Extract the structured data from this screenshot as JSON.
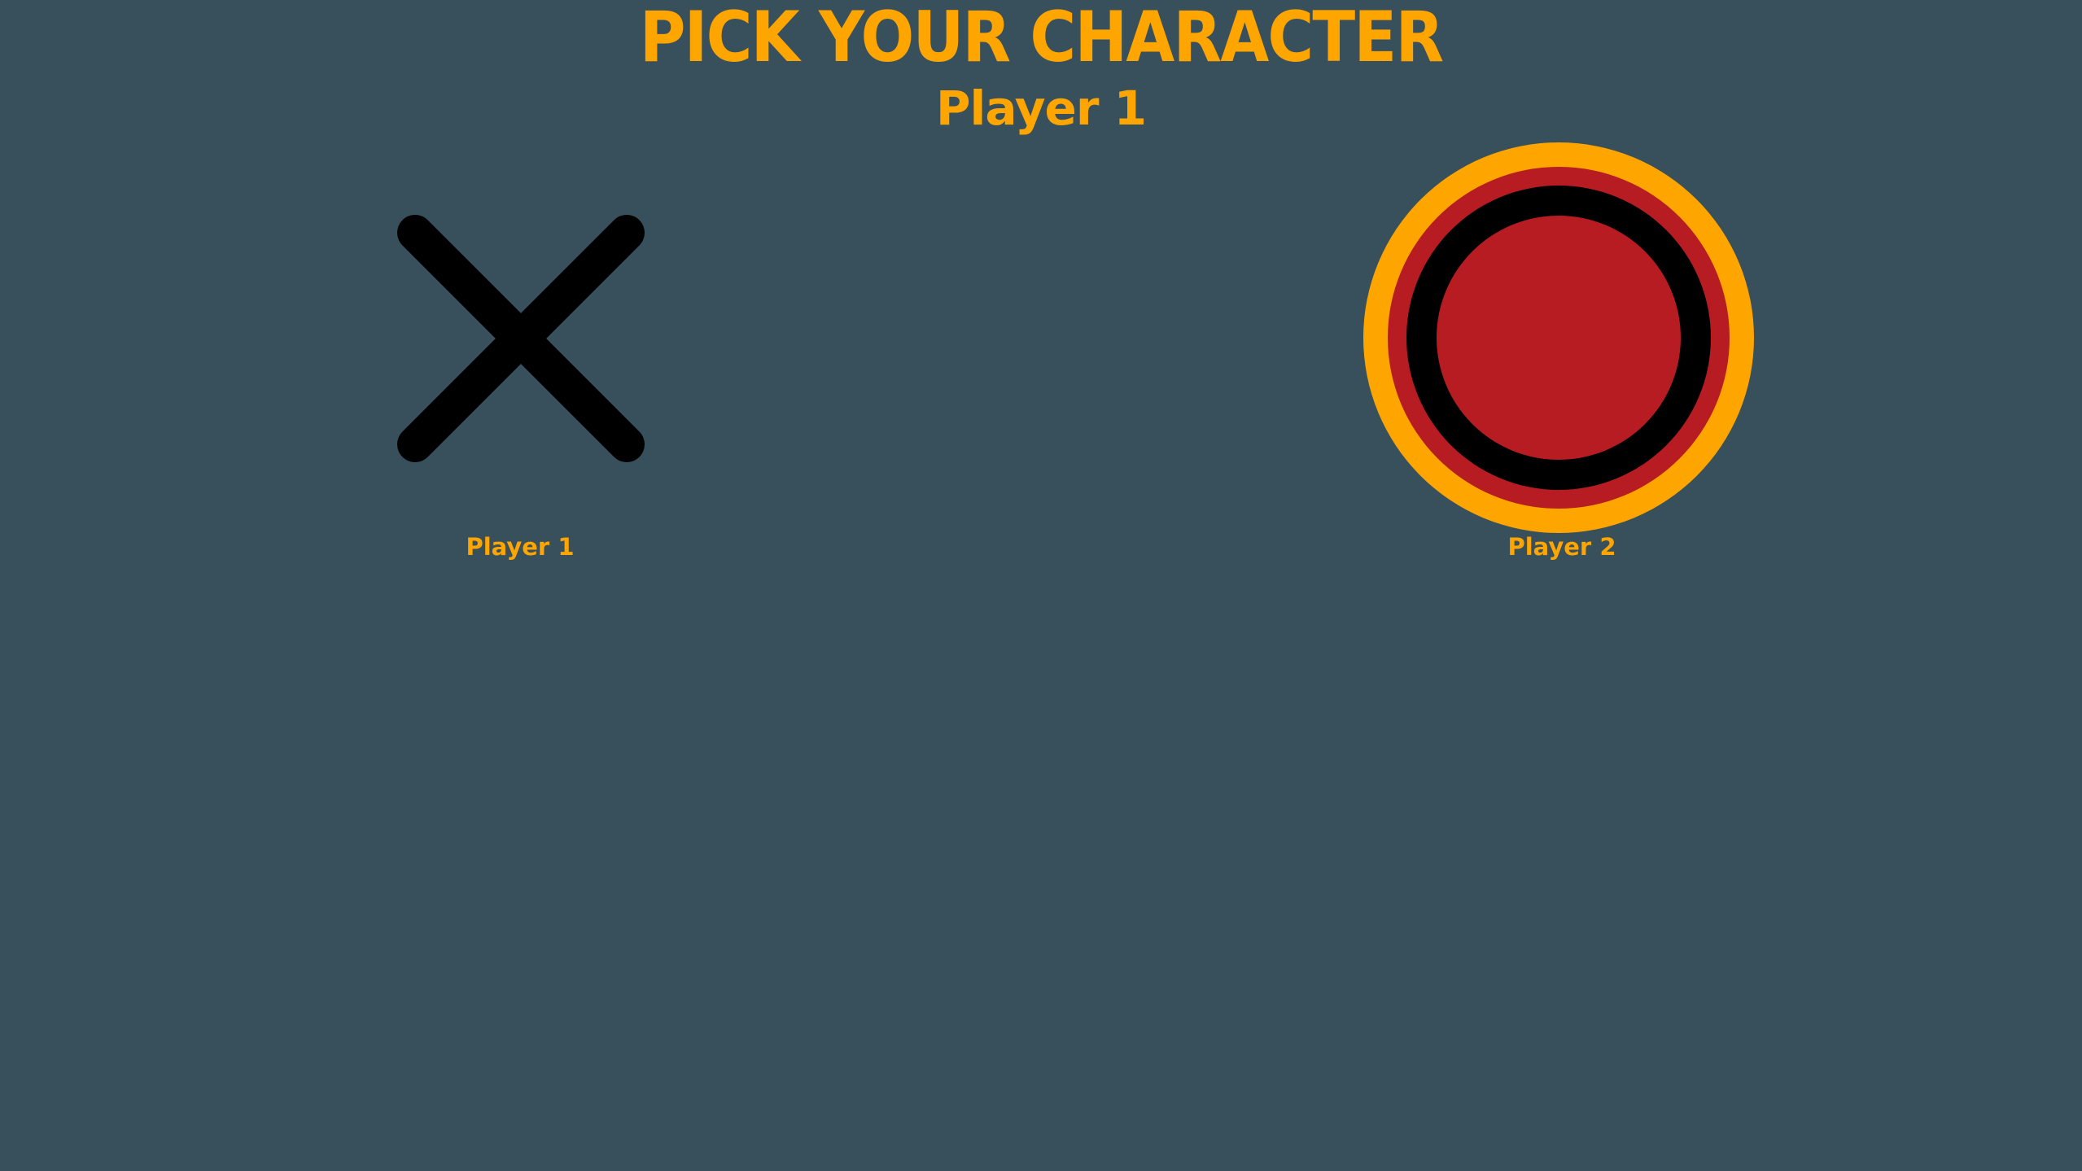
{
  "header": {
    "title": "PICK YOUR CHARACTER",
    "current_player": "Player 1"
  },
  "characters": [
    {
      "symbol": "x-mark-icon",
      "label": "Player 1"
    },
    {
      "symbol": "circle-token-icon",
      "label": "Player 2"
    }
  ],
  "colors": {
    "background": "#37505c",
    "accent": "#ffa500",
    "x_mark": "#000000",
    "token_red": "#b71c22",
    "token_ring_black": "#000000",
    "token_ring_orange": "#ffa500"
  }
}
